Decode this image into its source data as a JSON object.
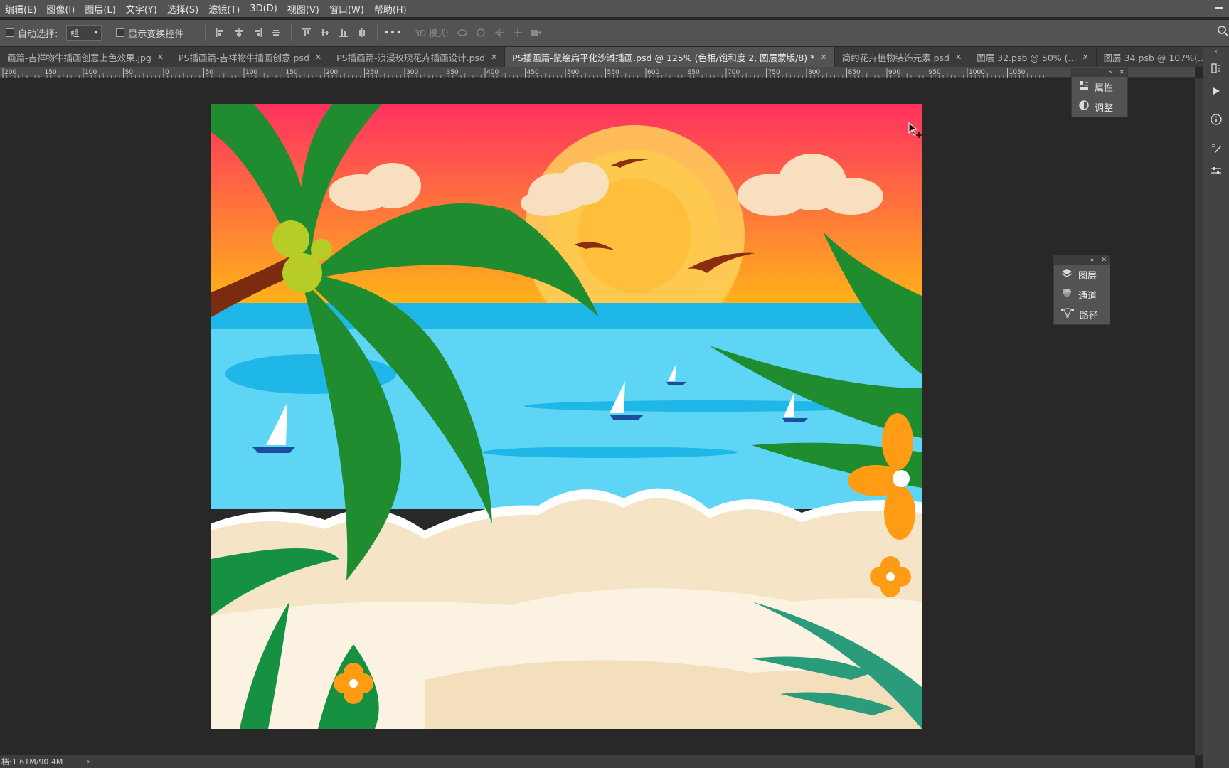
{
  "menu": [
    "编辑(E)",
    "图像(I)",
    "图层(L)",
    "文字(Y)",
    "选择(S)",
    "滤镜(T)",
    "3D(D)",
    "视图(V)",
    "窗口(W)",
    "帮助(H)"
  ],
  "options": {
    "auto_select_label": "自动选择:",
    "auto_select_value": "组",
    "show_transform_label": "显示变换控件",
    "mode3d_label": "3D 模式:",
    "more_label": "•••"
  },
  "tabs": [
    {
      "label": "画篇-吉祥物牛插画创意上色效果.jpg",
      "active": false
    },
    {
      "label": "PS插画篇-吉祥物牛插画创意.psd",
      "active": false
    },
    {
      "label": "PS插画篇-浪漫玫瑰花卉插画设计.psd",
      "active": false
    },
    {
      "label": "PS插画篇-鼠绘扁平化沙滩插画.psd @ 125% (色相/饱和度 2, 图层蒙版/8) *",
      "active": true
    },
    {
      "label": "简约花卉植物装饰元素.psd",
      "active": false
    },
    {
      "label": "图层 32.psb @ 50% (...",
      "active": false
    },
    {
      "label": "图层 34.psb @ 107%(...",
      "active": false
    }
  ],
  "ruler_labels": [
    "200",
    "150",
    "100",
    "50",
    "0",
    "50",
    "100",
    "150",
    "200",
    "250",
    "300",
    "350",
    "400",
    "450",
    "500",
    "550",
    "600",
    "650",
    "700",
    "750",
    "800",
    "850",
    "900",
    "950",
    "1000",
    "1050"
  ],
  "panels": {
    "top_panel": [
      {
        "label": "属性",
        "icon": "properties-icon"
      },
      {
        "label": "调整",
        "icon": "adjustments-icon"
      }
    ],
    "mid_panel": [
      {
        "label": "图层",
        "icon": "layers-icon"
      },
      {
        "label": "通道",
        "icon": "channels-icon"
      },
      {
        "label": "路径",
        "icon": "paths-icon"
      }
    ]
  },
  "status": {
    "doc_size": "档:1.61M/90.4M"
  },
  "colors": {
    "sky_top": "#ff3160",
    "sky_bottom": "#ffb21a",
    "sea": "#5fd5f6",
    "sea_dark": "#1eb7e8",
    "sand": "#f5e4c5",
    "palm": "#1e8c2f",
    "orange_flower": "#ff9c14"
  }
}
